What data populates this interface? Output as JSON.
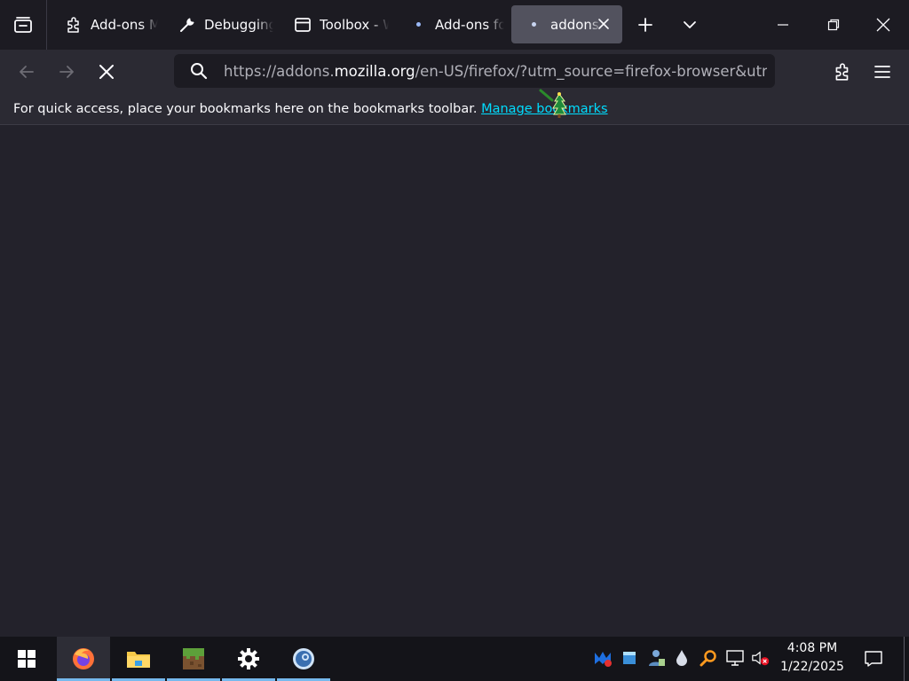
{
  "tabs": [
    {
      "title": "Add-ons M",
      "icon": "puzzle-icon",
      "active": false
    },
    {
      "title": "Debugging",
      "icon": "wrench-icon",
      "active": false
    },
    {
      "title": "Toolbox - W",
      "icon": "window-icon",
      "active": false
    },
    {
      "title": "Add-ons fo",
      "icon": "loading-dot-icon",
      "active": false
    },
    {
      "title": "addons.m",
      "icon": "loading-dot-icon",
      "active": true
    }
  ],
  "navbar": {
    "url_prefix": "https://addons.",
    "url_host": "mozilla.org",
    "url_suffix": "/en-US/firefox/?utm_source=firefox-browser&utm_ma"
  },
  "bookmarks": {
    "message": "For quick access, place your bookmarks here on the bookmarks toolbar.",
    "link": "Manage bookmarks"
  },
  "taskbar": {
    "apps": [
      "windows-start-icon",
      "firefox-icon",
      "file-explorer-icon",
      "minecraft-icon",
      "settings-icon",
      "steam-like-icon"
    ],
    "tray_icons": [
      "malwarebytes-icon",
      "tray-app-icon",
      "network-user-icon",
      "droplet-icon",
      "search-tool-icon",
      "network-icon",
      "volume-muted-icon"
    ],
    "time": "4:08 PM",
    "date": "1/22/2025"
  },
  "colors": {
    "accent": "#00ddff",
    "active_tab": "#52525e",
    "taskbar_indicator": "#76b9ed"
  }
}
